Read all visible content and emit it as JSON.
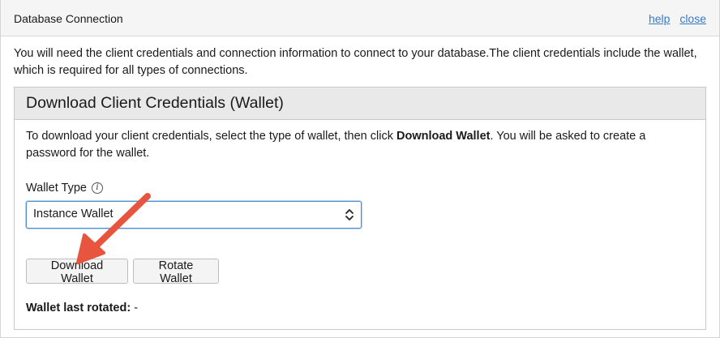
{
  "header": {
    "title": "Database Connection",
    "help_link": "help",
    "close_link": "close"
  },
  "intro_text": "You will need the client credentials and connection information to connect to your database.The client credentials include the wallet, which is required for all types of connections.",
  "panel": {
    "title": "Download Client Credentials (Wallet)",
    "instructions_before": "To download your client credentials, select the type of wallet, then click ",
    "instructions_bold": "Download Wallet",
    "instructions_after": ". You will be asked to create a password for the wallet.",
    "wallet_type_label": "Wallet Type",
    "info_icon": "i",
    "wallet_type_selected": "Instance Wallet",
    "download_button": "Download Wallet",
    "rotate_button": "Rotate Wallet",
    "last_rotated_label": "Wallet last rotated:",
    "last_rotated_value": "-"
  },
  "colors": {
    "link": "#3a78c6",
    "annotation_arrow": "#e8553f",
    "select_focus": "#4d8fd6"
  }
}
